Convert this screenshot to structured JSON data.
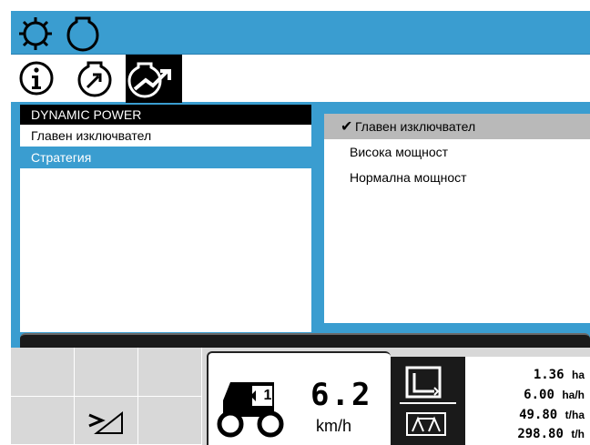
{
  "list": {
    "title": "DYNAMIC POWER",
    "items": [
      {
        "label": "Главен изключвател"
      },
      {
        "label": "Стратегия"
      }
    ]
  },
  "popup": {
    "options": [
      {
        "label": "Главен изключвател",
        "selected": true
      },
      {
        "label": "Висока мощност",
        "selected": false
      },
      {
        "label": "Нормална мощност",
        "selected": false
      }
    ]
  },
  "status": {
    "gear_number": "1",
    "speed_value": "6.2",
    "speed_unit": "km/h",
    "stats": [
      {
        "value": "1.36",
        "unit": "ha"
      },
      {
        "value": "6.00",
        "unit": "ha/h"
      },
      {
        "value": "49.80",
        "unit": "t/ha"
      },
      {
        "value": "298.80",
        "unit": "t/h"
      }
    ]
  },
  "colors": {
    "accent_blue": "#3a9dd0",
    "selection_gray": "#b9b9b9",
    "dark": "#1a1a1a"
  },
  "icons": {
    "top_row": [
      "gear-icon",
      "engine-icon"
    ],
    "menu_row": [
      "info-icon",
      "engine-speed-icon",
      "dynamic-power-icon"
    ],
    "status": [
      "tractor-icon",
      "area-frame-icon",
      "yield-scale-icon",
      "pto-lever-icon"
    ]
  }
}
